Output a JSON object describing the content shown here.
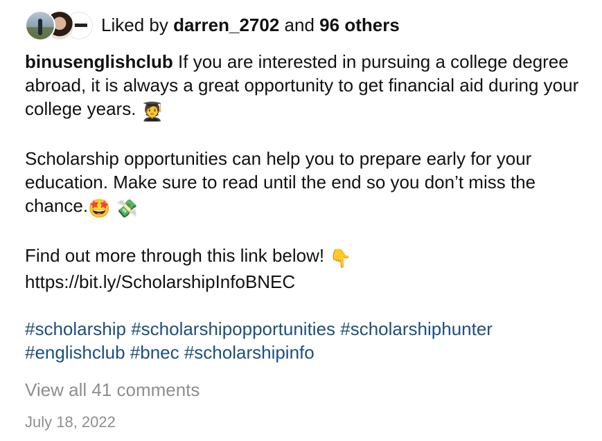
{
  "likes": {
    "prefix": "Liked by",
    "user": "darren_2702",
    "connector": "and",
    "others": "96 others"
  },
  "avatars": [
    {
      "icon": "profile-photo-landscape"
    },
    {
      "icon": "profile-photo-person"
    },
    {
      "icon": "profile-photo-logo"
    }
  ],
  "caption": {
    "username": "binusenglishclub",
    "para1": "If you are interested in pursuing a college degree abroad, it is always a great opportunity to get financial aid during your college years.",
    "emoji1": "🧑‍🎓",
    "para2": "Scholarship opportunities can help you to prepare early for your education. Make sure to read until the end so you don’t miss the chance.",
    "emoji2a": "🤩",
    "emoji2b": "💸",
    "para3": "Find out more through this link below!",
    "emoji3": "👇",
    "link": "https://bit.ly/ScholarshipInfoBNEC",
    "hashtags_line1": "#scholarship #scholarshipopportunities #scholarshiphunter",
    "hashtags_line2": "#englishclub #bnec #scholarshipinfo"
  },
  "view_all_comments": "View all 41 comments",
  "date": "July 18, 2022",
  "colors": {
    "hashtag": "#1d4f7e",
    "muted": "#8e8e8e",
    "text": "#111111"
  }
}
